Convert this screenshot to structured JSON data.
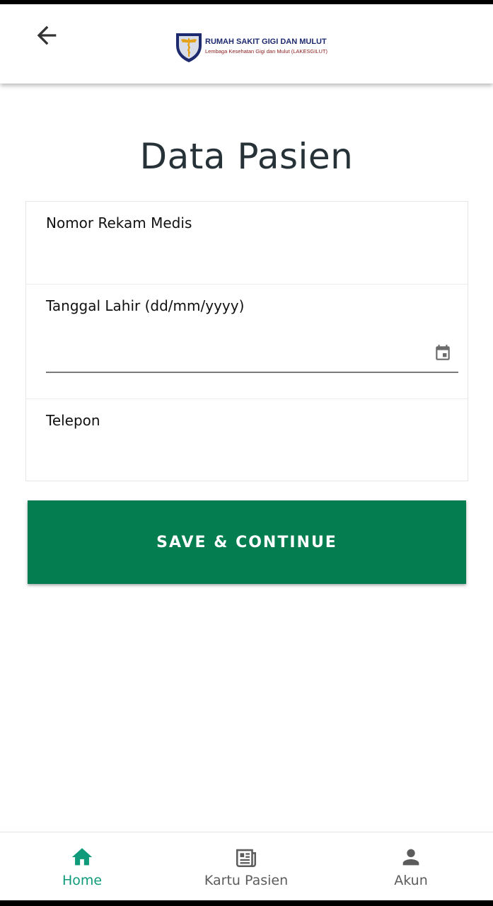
{
  "app_bar": {
    "back_icon": "arrow-left-icon",
    "logo": {
      "title": "RUMAH SAKIT GIGI DAN MULUT",
      "subtitle": "Lembaga Kesehatan Gigi dan Mulut (LAKESGILUT)"
    }
  },
  "page": {
    "title": "Data Pasien"
  },
  "form": {
    "fields": [
      {
        "label": "Nomor Rekam Medis",
        "value": ""
      },
      {
        "label": "Tanggal Lahir (dd/mm/yyyy)",
        "value": "",
        "icon": "calendar-icon"
      },
      {
        "label": "Telepon",
        "value": ""
      }
    ],
    "submit_label": "SAVE & CONTINUE"
  },
  "bottom_nav": {
    "items": [
      {
        "label": "Home",
        "icon": "home-icon",
        "active": true
      },
      {
        "label": "Kartu Pasien",
        "icon": "newspaper-icon",
        "active": false
      },
      {
        "label": "Akun",
        "icon": "person-icon",
        "active": false
      }
    ]
  },
  "colors": {
    "primary_button": "#047d50",
    "active_nav": "#0f9b7a",
    "inactive_nav": "#5c5c5c",
    "title_text": "#263238"
  }
}
